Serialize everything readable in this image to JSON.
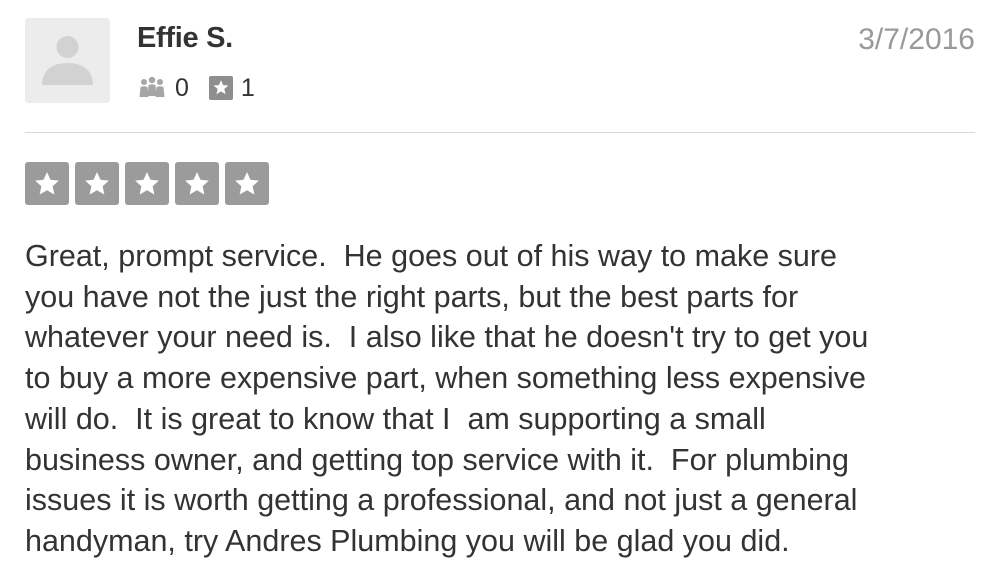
{
  "review": {
    "user": {
      "name": "Effie S.",
      "avatar_icon": "default-user-silhouette-icon",
      "friends_icon": "friends-icon",
      "friends_count": "0",
      "reviews_icon": "review-star-icon",
      "reviews_count": "1"
    },
    "date": "3/7/2016",
    "rating": {
      "value": 5,
      "max": 5,
      "star_color": "#9b9b9b"
    },
    "text": "Great, prompt service.  He goes out of his way to make sure\nyou have not the just the right parts, but the best parts for\nwhatever your need is.  I also like that he doesn't try to get you\nto buy a more expensive part, when something less expensive\nwill do.  It is great to know that I  am supporting a small\nbusiness owner, and getting top service with it.  For plumbing\nissues it is worth getting a professional, and not just a general\nhandyman, try Andres Plumbing you will be glad you did."
  }
}
